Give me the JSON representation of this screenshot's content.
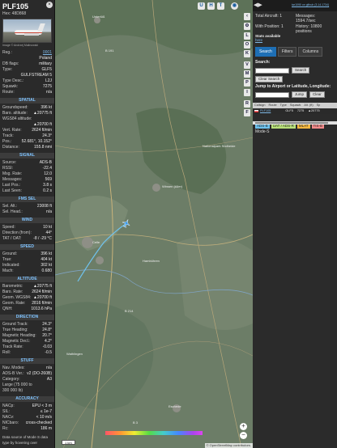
{
  "panel": {
    "callsign": "PLF105",
    "hex_label": "Hex:",
    "hex": "48D868",
    "close": "×",
    "photo_credit": "Image © Andrzej Malinowski",
    "meta": [
      {
        "k": "Reg.:",
        "v": "0001",
        "link": true
      },
      {
        "k": "",
        "v": "Poland",
        "link": false
      },
      {
        "k": "DB flags:",
        "v": "military",
        "link": false
      },
      {
        "k": "Type:",
        "v": "GLF5",
        "link": false
      },
      {
        "k": "",
        "v": "GULFSTREAM 5",
        "link": false
      },
      {
        "k": "Type Desc.:",
        "v": "L2J",
        "link": false
      },
      {
        "k": "Squawk:",
        "v": "7275",
        "link": false
      },
      {
        "k": "Route:",
        "v": "n/a",
        "link": false
      }
    ],
    "sections": [
      {
        "title": "SPATIAL",
        "rows": [
          {
            "k": "Groundspeed:",
            "v": "396 kt"
          },
          {
            "k": "Baro. altitude:",
            "v": "▲20775 ft"
          },
          {
            "k": "WGS84 altitude:",
            "v": ""
          },
          {
            "k": "",
            "v": "▲20700 ft"
          },
          {
            "k": "Vert. Rate:",
            "v": "2624 ft/min"
          },
          {
            "k": "Track:",
            "v": "24.3°"
          },
          {
            "k": "Pos.:",
            "v": "52.681°, 10.152°"
          },
          {
            "k": "Distance:",
            "v": "155.8 nmi"
          }
        ]
      },
      {
        "title": "SIGNAL",
        "rows": [
          {
            "k": "Source:",
            "v": "ADS-B"
          },
          {
            "k": "RSSI:",
            "v": "-22.4"
          },
          {
            "k": "Msg. Rate:",
            "v": "12.0"
          },
          {
            "k": "Messages:",
            "v": "569"
          },
          {
            "k": "Last Pos.:",
            "v": "3.8 s"
          },
          {
            "k": "Last Seen:",
            "v": "0.2 s"
          }
        ]
      },
      {
        "title": "FMS SEL",
        "rows": [
          {
            "k": "Sel. Alt.:",
            "v": "23008 ft"
          },
          {
            "k": "Sel. Head.:",
            "v": "n/a"
          }
        ]
      },
      {
        "title": "WIND",
        "rows": [
          {
            "k": "Speed:",
            "v": "10 kt"
          },
          {
            "k": "Direction (from):",
            "v": "44°"
          },
          {
            "k": "TAT / OAT:",
            "v": "-8 / -29 °C"
          }
        ]
      },
      {
        "title": "SPEED",
        "rows": [
          {
            "k": "Ground:",
            "v": "396 kt"
          },
          {
            "k": "True:",
            "v": "404 kt"
          },
          {
            "k": "Indicated:",
            "v": "302 kt"
          },
          {
            "k": "Mach:",
            "v": "0.680"
          }
        ]
      },
      {
        "title": "ALTITUDE",
        "rows": [
          {
            "k": "Barometric:",
            "v": "▲20775 ft"
          },
          {
            "k": "Baro. Rate:",
            "v": "2624 ft/min"
          },
          {
            "k": "Geom. WGS84:",
            "v": "▲20700 ft"
          },
          {
            "k": "Geom. Rate:",
            "v": "2816 ft/min"
          },
          {
            "k": "QNH:",
            "v": "1013.6 hPa"
          }
        ]
      },
      {
        "title": "DIRECTION",
        "rows": [
          {
            "k": "Ground Track:",
            "v": "24.3°"
          },
          {
            "k": "True Heading:",
            "v": "24.8°"
          },
          {
            "k": "Magnetic Heading:",
            "v": "20.7°"
          },
          {
            "k": "Magnetic Decl.:",
            "v": "4.2°"
          },
          {
            "k": "Track Rate:",
            "v": "-0.03"
          },
          {
            "k": "Roll:",
            "v": "-0.5"
          }
        ]
      },
      {
        "title": "STUFF",
        "rows": [
          {
            "k": "Nav. Modes:",
            "v": "n/a"
          },
          {
            "k": "ADS-B Ver.:",
            "v": "v2 (DO-260B)"
          },
          {
            "k": "Category:",
            "v": "A3"
          },
          {
            "k": "Large (75 000 to",
            "v": ""
          },
          {
            "k": "300 000 lb)",
            "v": ""
          }
        ]
      },
      {
        "title": "ACCURACY",
        "rows": [
          {
            "k": "NACp:",
            "v": "EPU < 3 m"
          },
          {
            "k": "SIL:",
            "v": "≤ 1e-7"
          },
          {
            "k": "NACv:",
            "v": "< 10 m/s"
          },
          {
            "k": "NICbaro:",
            "v": "cross-checked"
          },
          {
            "k": "Rc:",
            "v": "186 m"
          }
        ]
      }
    ],
    "footer": "Data source of Mode S data type by hovering over"
  },
  "map": {
    "top_buttons": [
      "U",
      "H",
      "T"
    ],
    "side_buttons": [
      "L",
      "O",
      "K",
      "V",
      "M",
      "P",
      "I",
      "R",
      "F"
    ],
    "zoom_in": "+",
    "zoom_out": "−",
    "scale": "1 km",
    "attribution": "© OpenStreetMap contributors.",
    "labels": [
      "Unterlüß",
      "Nationalpark Südheide",
      "B 191",
      "B 214",
      "Celle",
      "Wathlingen",
      "Hambühren",
      "Winsen (Aller)",
      "Eschede",
      "B 3"
    ]
  },
  "sidebar": {
    "toggle": "◀▶",
    "top_link": "tar1090 on github (3.14.1734)",
    "stats": [
      {
        "k": "Total Aircraft:",
        "v": "1"
      },
      {
        "k": "Messages:",
        "v": "1594.7/sec"
      },
      {
        "k": "With Position:",
        "v": "1"
      },
      {
        "k": "History:",
        "v": "10800 positions"
      }
    ],
    "stats_link": "Stats available",
    "stats_link2": "here",
    "tabs": [
      "Search",
      "Filters",
      "Columns"
    ],
    "active_tab": 0,
    "search_label": "Search:",
    "search_button": "Search",
    "clear_search": "Clear Search",
    "jump_label": "Jump to Airport or Latitude, Longitude:",
    "jump_button": "Jump",
    "clear_button": "Clear",
    "table_headers": [
      "Callsign",
      "Route",
      "Type",
      "Squawk",
      "Alt. (ft)",
      "Sp"
    ],
    "table_row": {
      "callsign": "PLF105",
      "type": "GLF5",
      "squawk": "7275",
      "alt": "▲20775"
    },
    "legend": [
      {
        "label": "ADS-B",
        "color": "#6fc3ef"
      },
      {
        "label": "UAT / ADS-R",
        "color": "#b9e07a"
      },
      {
        "label": "MLAT",
        "color": "#f5b841"
      },
      {
        "label": "TIS-B",
        "color": "#f38b8b"
      }
    ],
    "mode_s": "Mode-S"
  }
}
